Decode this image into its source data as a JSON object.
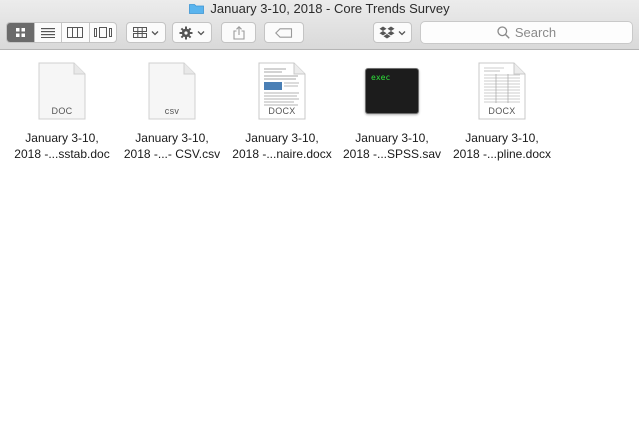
{
  "window": {
    "title": "January 3-10, 2018 - Core Trends Survey",
    "folder_color": "#5ab4ee"
  },
  "toolbar": {
    "view_modes": [
      "icon-view",
      "list-view",
      "column-view",
      "cover-flow-view"
    ],
    "active_view": "icon-view",
    "search_placeholder": "Search"
  },
  "files": [
    {
      "line1": "January 3-10,",
      "line2": "2018 -...sstab.doc",
      "type_label": "DOC",
      "icon": "doc-file-icon"
    },
    {
      "line1": "January 3-10,",
      "line2": "2018 -...- CSV.csv",
      "type_label": "csv",
      "icon": "csv-file-icon"
    },
    {
      "line1": "January 3-10,",
      "line2": "2018 -...naire.docx",
      "type_label": "DOCX",
      "icon": "docx-file-icon"
    },
    {
      "line1": "January 3-10,",
      "line2": "2018 -...SPSS.sav",
      "type_label": "exec",
      "icon": "exec-file-icon"
    },
    {
      "line1": "January 3-10,",
      "line2": "2018 -...pline.docx",
      "type_label": "DOCX",
      "icon": "docx-file-icon"
    }
  ]
}
